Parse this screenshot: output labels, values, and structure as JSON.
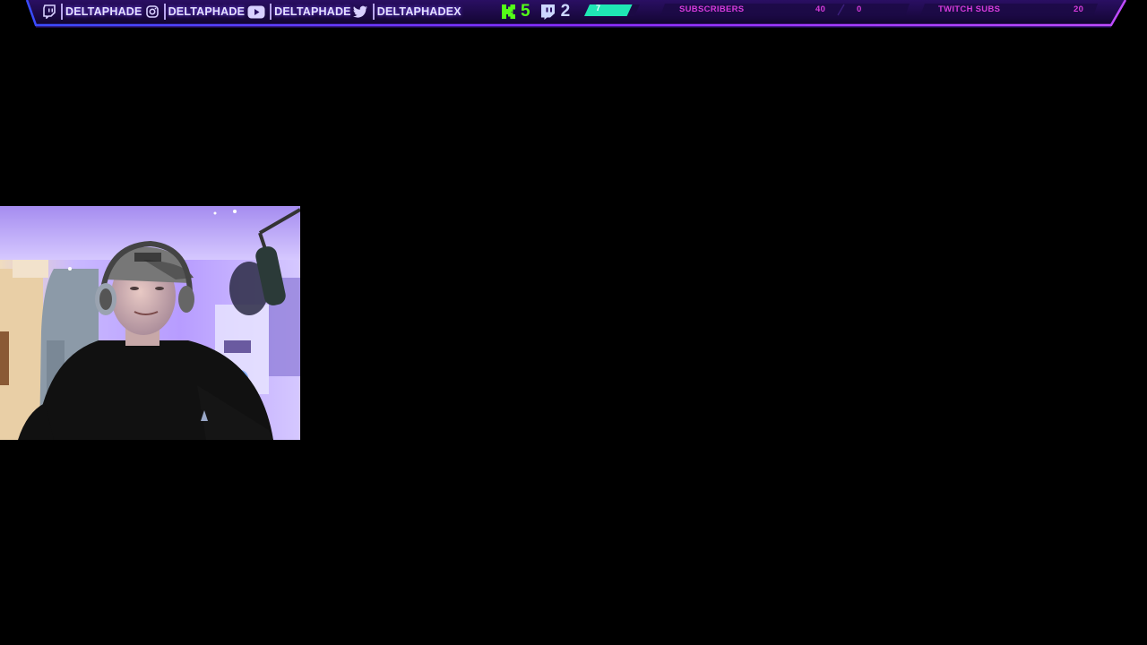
{
  "overlay": {
    "socials": [
      {
        "platform": "twitch-icon",
        "handle": "DELTAPHADE"
      },
      {
        "platform": "instagram-icon",
        "handle": "DELTAPHADE"
      },
      {
        "platform": "youtube-icon",
        "handle": "DELTAPHADE"
      },
      {
        "platform": "twitter-icon",
        "handle": "DELTAPHADEX"
      }
    ],
    "counters": {
      "kick_icon": "kick-icon",
      "kick_count": "5",
      "twitch_icon": "twitch-chat-icon",
      "twitch_count": "2"
    },
    "progress": {
      "value": "7",
      "fill_fraction": 0.85
    },
    "goals": [
      {
        "label": "SUBSCRIBERS",
        "target": "40",
        "current": "0"
      },
      {
        "label": "TWITCH SUBS",
        "target": "20"
      }
    ],
    "colors": {
      "accent_purple": "#7b2cff",
      "kick_green": "#53fc18",
      "progress_teal": "#1fe7b4",
      "goal_magenta": "#d63bdc",
      "bar_background": "#1a0a3d"
    }
  },
  "webcam": {
    "description_icon": "webcam-feed"
  }
}
